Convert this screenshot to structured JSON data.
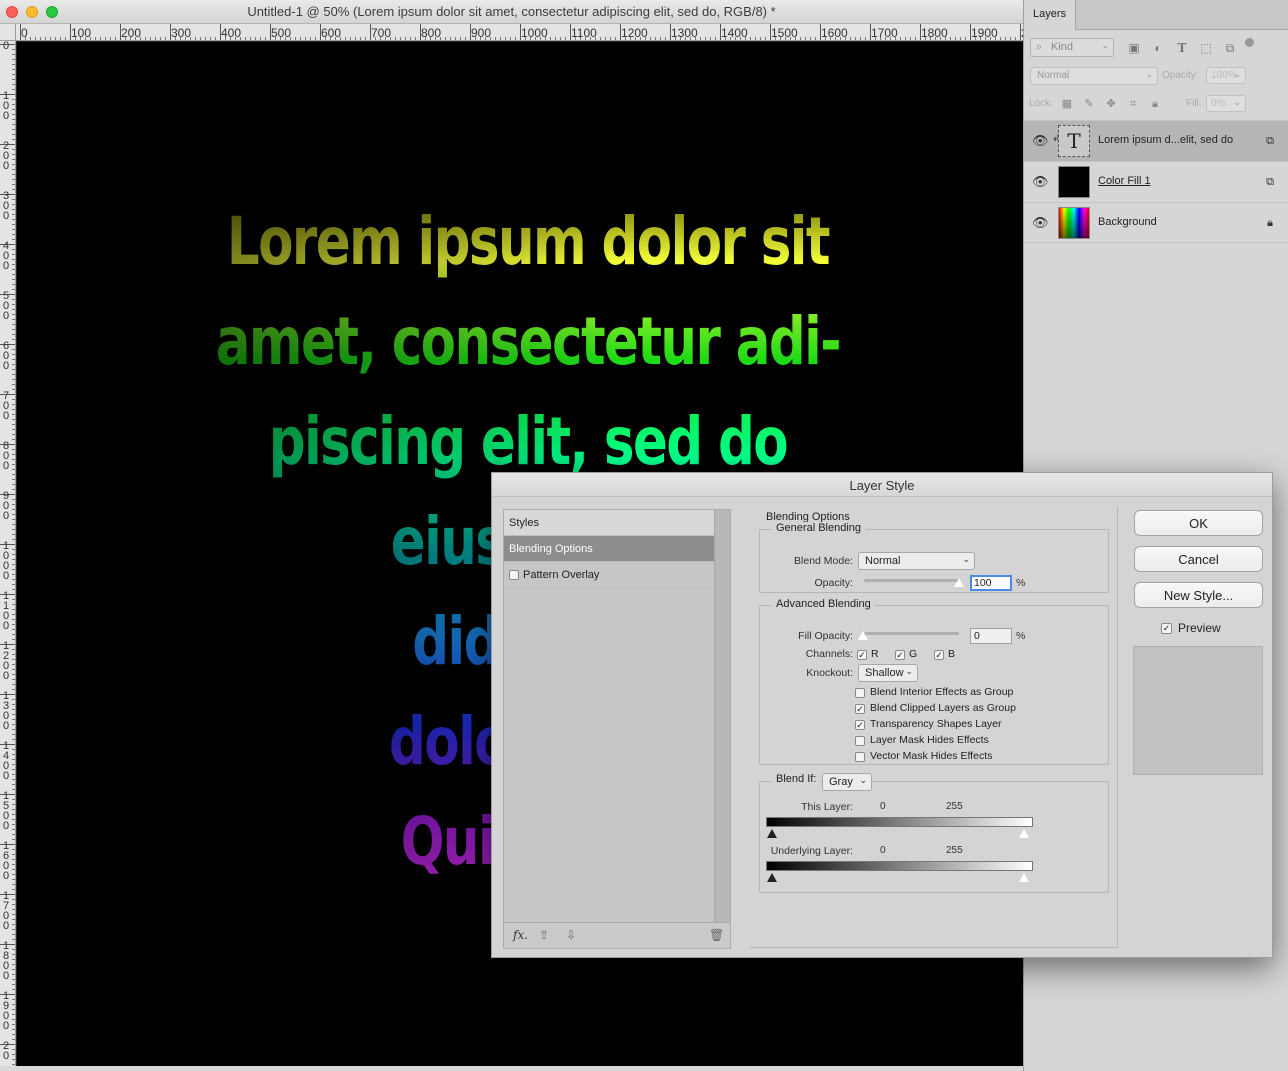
{
  "document": {
    "title": "Untitled-1 @ 50% (Lorem ipsum dolor sit amet, consectetur adipiscing elit, sed do, RGB/8) *",
    "ruler_h": [
      "0",
      "100",
      "200",
      "300",
      "400",
      "500",
      "600",
      "700",
      "800",
      "900",
      "1000",
      "1100",
      "1200",
      "1300",
      "1400",
      "1500",
      "1600",
      "1700",
      "1800",
      "1900",
      "2"
    ],
    "ruler_v": [
      "0",
      "1 0 0",
      "2 0 0",
      "3 0 0",
      "4 0 0",
      "5 0 0",
      "6 0 0",
      "7 0 0",
      "8 0 0",
      "9 0 0",
      "1 0 0 0",
      "1 1 0 0",
      "1 2 0 0",
      "1 3 0 0",
      "1 4 0 0",
      "1 5 0 0",
      "1 6 0 0",
      "1 7 0 0",
      "1 8 0 0",
      "1 9 0 0",
      "2 0"
    ],
    "canvas_lines": [
      "Lorem ipsum dolor sit",
      "amet, consectetur adi-",
      "piscing elit, sed do",
      "eiusmod t",
      "didunt u",
      "dolore ma",
      "Quis ipsu"
    ]
  },
  "layers_panel": {
    "tab": "Layers",
    "kind_filter": "Kind",
    "filter_icons": [
      "image-filter-icon",
      "adjustment-filter-icon",
      "type-filter-icon",
      "shape-filter-icon",
      "smart-object-filter-icon"
    ],
    "blend_mode": "Normal",
    "opacity_label": "Opacity:",
    "opacity_value": "100%",
    "lock_label": "Lock:",
    "fill_label": "Fill:",
    "fill_value": "0%",
    "layers": [
      {
        "name": "Lorem ipsum d...elit, sed do",
        "type": "text",
        "selected": true
      },
      {
        "name": "Color Fill 1",
        "type": "fill",
        "selected": false
      },
      {
        "name": "Background",
        "type": "background",
        "selected": false
      }
    ]
  },
  "dialog": {
    "title": "Layer Style",
    "styles_header": "Styles",
    "styles_items": [
      {
        "label": "Blending Options",
        "active": true
      },
      {
        "label": "Pattern Overlay",
        "checked": false
      }
    ],
    "section_title": "Blending Options",
    "general_blending": {
      "label": "General Blending",
      "blend_mode_label": "Blend Mode:",
      "blend_mode": "Normal",
      "opacity_label": "Opacity:",
      "opacity_value": "100",
      "pct": "%"
    },
    "advanced_blending": {
      "label": "Advanced Blending",
      "fill_opacity_label": "Fill Opacity:",
      "fill_opacity_value": "0",
      "pct": "%",
      "channels_label": "Channels:",
      "channels": [
        {
          "label": "R",
          "checked": true
        },
        {
          "label": "G",
          "checked": true
        },
        {
          "label": "B",
          "checked": true
        }
      ],
      "knockout_label": "Knockout:",
      "knockout": "Shallow",
      "options": [
        {
          "label": "Blend Interior Effects as Group",
          "checked": false
        },
        {
          "label": "Blend Clipped Layers as Group",
          "checked": true
        },
        {
          "label": "Transparency Shapes Layer",
          "checked": true
        },
        {
          "label": "Layer Mask Hides Effects",
          "checked": false
        },
        {
          "label": "Vector Mask Hides Effects",
          "checked": false
        }
      ]
    },
    "blend_if": {
      "label": "Blend If:",
      "channel": "Gray",
      "this_layer_label": "This Layer:",
      "this_layer_min": "0",
      "this_layer_max": "255",
      "underlying_label": "Underlying Layer:",
      "underlying_min": "0",
      "underlying_max": "255"
    },
    "buttons": {
      "ok": "OK",
      "cancel": "Cancel",
      "new_style": "New Style..."
    },
    "preview_label": "Preview",
    "preview_checked": true
  }
}
